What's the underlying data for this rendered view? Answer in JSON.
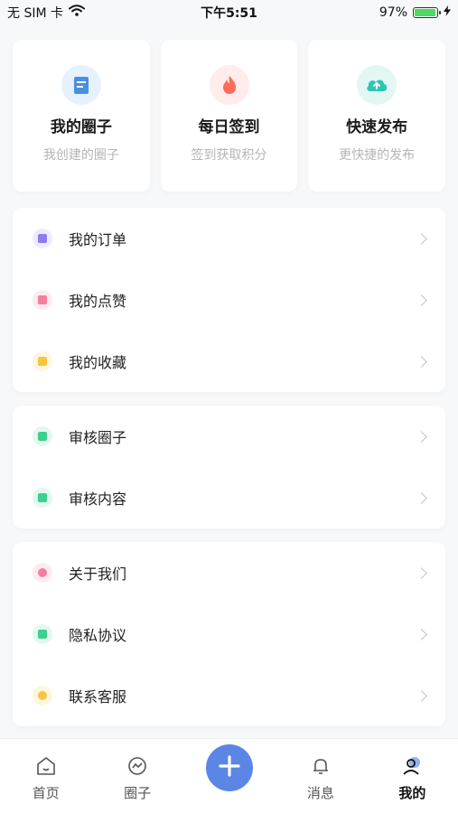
{
  "status": {
    "carrier": "无 SIM 卡",
    "time": "下午5:51",
    "battery": "97%",
    "battery_level": 0.97
  },
  "quick": [
    {
      "title": "我的圈子",
      "sub": "我创建的圈子",
      "icon": "circle-book-icon",
      "color": "#4a90e2"
    },
    {
      "title": "每日签到",
      "sub": "签到获取积分",
      "icon": "fire-icon",
      "color": "#ff6b5a"
    },
    {
      "title": "快速发布",
      "sub": "更快捷的发布",
      "icon": "cloud-upload-icon",
      "color": "#2cc7b0"
    }
  ],
  "groups": [
    [
      {
        "label": "我的订单",
        "icon": "order-icon",
        "color": "#8c7cf0"
      },
      {
        "label": "我的点赞",
        "icon": "thumb-up-icon",
        "color": "#f57fa0"
      },
      {
        "label": "我的收藏",
        "icon": "bookmark-icon",
        "color": "#f6c542"
      }
    ],
    [
      {
        "label": "审核圈子",
        "icon": "review-circle-icon",
        "color": "#3ccf8e"
      },
      {
        "label": "审核内容",
        "icon": "review-content-icon",
        "color": "#3ccf8e"
      }
    ],
    [
      {
        "label": "关于我们",
        "icon": "heart-icon",
        "color": "#f57fa0"
      },
      {
        "label": "隐私协议",
        "icon": "privacy-icon",
        "color": "#3ccf8e"
      },
      {
        "label": "联系客服",
        "icon": "service-icon",
        "color": "#f6c542"
      }
    ]
  ],
  "tabs": [
    {
      "label": "首页",
      "icon": "home-icon"
    },
    {
      "label": "圈子",
      "icon": "circle-icon"
    },
    {
      "label": "",
      "icon": "add-icon"
    },
    {
      "label": "消息",
      "icon": "bell-icon"
    },
    {
      "label": "我的",
      "icon": "user-icon",
      "active": true
    }
  ]
}
